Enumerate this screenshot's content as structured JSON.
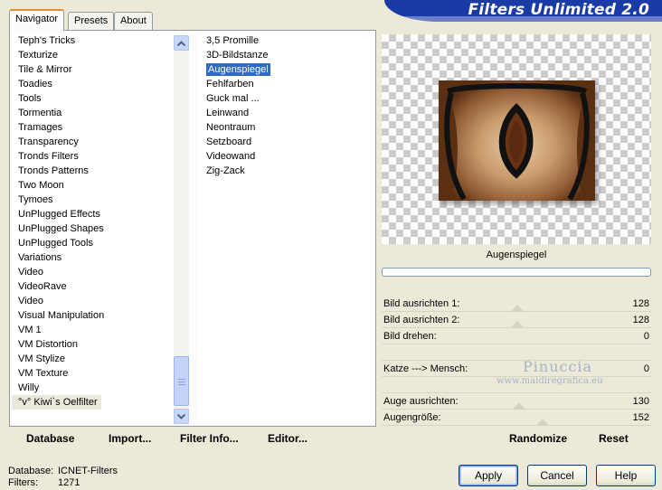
{
  "tabs": [
    {
      "label": "Navigator",
      "active": true
    },
    {
      "label": "Presets",
      "active": false
    },
    {
      "label": "About",
      "active": false
    }
  ],
  "banner": {
    "title": "Filters Unlimited 2.0"
  },
  "categories": {
    "items": [
      "Teph's Tricks",
      "Texturize",
      "Tile & Mirror",
      "Toadies",
      "Tools",
      "Tormentia",
      "Tramages",
      "Transparency",
      "Tronds Filters",
      "Tronds Patterns",
      "Two Moon",
      "Tymoes",
      "UnPlugged Effects",
      "UnPlugged Shapes",
      "UnPlugged Tools",
      "Variations",
      "Video",
      "VideoRave",
      "Video",
      "Visual Manipulation",
      "VM 1",
      "VM Distortion",
      "VM Stylize",
      "VM Texture",
      "Willy",
      "°v° Kiwi`s Oelfilter"
    ],
    "selected_index": 25
  },
  "filters": {
    "items": [
      "3,5 Promille",
      "3D-Bildstanze",
      "Augenspiegel",
      "Fehlfarben",
      "Guck mal ...",
      "Leinwand",
      "Neontraum",
      "Setzboard",
      "Videowand",
      "Zig-Zack"
    ],
    "selected_index": 2
  },
  "preview": {
    "filter_name": "Augenspiegel"
  },
  "params": [
    {
      "label": "Bild ausrichten 1:",
      "value": "128",
      "level": 0.502
    },
    {
      "label": "Bild ausrichten 2:",
      "value": "128",
      "level": 0.502
    },
    {
      "label": "Bild drehen:",
      "value": "0",
      "level": 0
    },
    {
      "label": "",
      "value": "",
      "level": null
    },
    {
      "label": "Katze ---> Mensch:",
      "value": "0",
      "level": 0
    },
    {
      "label": "",
      "value": "",
      "level": null
    },
    {
      "label": "Auge ausrichten:",
      "value": "130",
      "level": 0.51
    },
    {
      "label": "Augengröße:",
      "value": "152",
      "level": 0.596
    }
  ],
  "actions": {
    "database": "Database",
    "import": "Import...",
    "filter_info": "Filter Info...",
    "editor": "Editor...",
    "randomize": "Randomize",
    "reset": "Reset"
  },
  "status": {
    "database_label": "Database:",
    "database_value": "ICNET-Filters",
    "filters_label": "Filters:",
    "filters_value": "1271"
  },
  "buttons": {
    "apply": "Apply",
    "cancel": "Cancel",
    "help": "Help"
  },
  "watermark": {
    "name": "Pinuccia",
    "url": "www.maidiregrafica.eu"
  },
  "colors": {
    "selection": "#316ac5",
    "banner": "#1a3aa6",
    "dialog_bg": "#ece9d8"
  }
}
